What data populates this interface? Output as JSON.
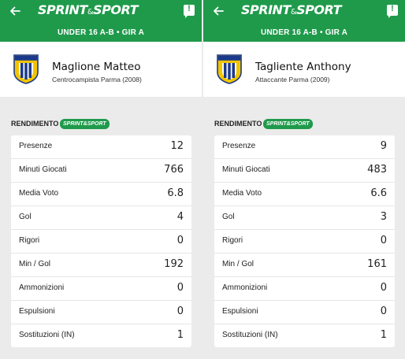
{
  "app": {
    "logo_main": "SPRINT",
    "logo_amp": "&",
    "logo_end": "SPORT",
    "badge": "SPRINT&SPORT"
  },
  "colors": {
    "brand": "#1f9a4b",
    "background": "#ebebeb"
  },
  "icons": {
    "back": "arrow-left-icon",
    "alert": "alert-chat-icon",
    "crest": "parma-calcio-crest"
  },
  "screens": [
    {
      "subtitle": "UNDER 16 A-B • GIR A",
      "player": {
        "name": "Maglione Matteo",
        "role": "Centrocampista Parma (2008)"
      },
      "section_label": "RENDIMENTO",
      "stats": [
        {
          "label": "Presenze",
          "value": "12"
        },
        {
          "label": "Minuti Giocati",
          "value": "766"
        },
        {
          "label": "Media Voto",
          "value": "6.8"
        },
        {
          "label": "Gol",
          "value": "4"
        },
        {
          "label": "Rigori",
          "value": "0"
        },
        {
          "label": "Min / Gol",
          "value": "192"
        },
        {
          "label": "Ammonizioni",
          "value": "0"
        },
        {
          "label": "Espulsioni",
          "value": "0"
        },
        {
          "label": "Sostituzioni (IN)",
          "value": "1"
        }
      ]
    },
    {
      "subtitle": "UNDER 16 A-B • GIR A",
      "player": {
        "name": "Tagliente Anthony",
        "role": "Attaccante Parma (2009)"
      },
      "section_label": "RENDIMENTO",
      "stats": [
        {
          "label": "Presenze",
          "value": "9"
        },
        {
          "label": "Minuti Giocati",
          "value": "483"
        },
        {
          "label": "Media Voto",
          "value": "6.6"
        },
        {
          "label": "Gol",
          "value": "3"
        },
        {
          "label": "Rigori",
          "value": "0"
        },
        {
          "label": "Min / Gol",
          "value": "161"
        },
        {
          "label": "Ammonizioni",
          "value": "0"
        },
        {
          "label": "Espulsioni",
          "value": "0"
        },
        {
          "label": "Sostituzioni (IN)",
          "value": "1"
        }
      ]
    }
  ]
}
